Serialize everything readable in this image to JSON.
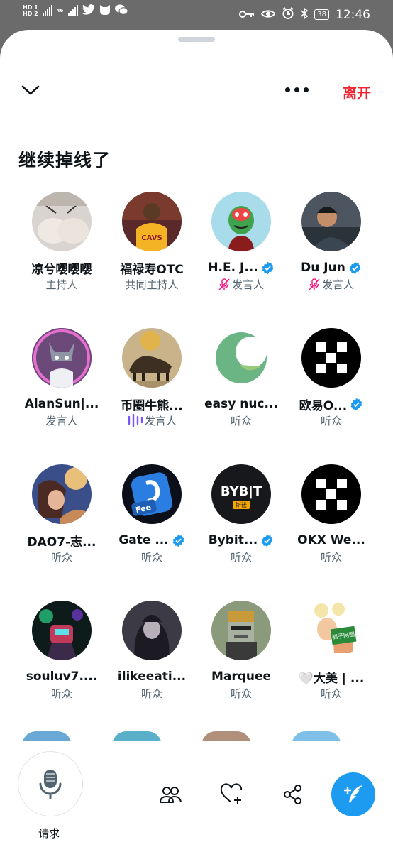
{
  "status_bar": {
    "time": "12:46",
    "battery": "38",
    "sim1": "HD 1",
    "sim2": "HD 2",
    "net": "46"
  },
  "header": {
    "leave_label": "离开",
    "title": "继续掉线了"
  },
  "participants": [
    {
      "name": "凉兮嘤嘤嘤",
      "role": "主持人",
      "verified": false,
      "role_icon": ""
    },
    {
      "name": "福禄寿OTC",
      "role": "共同主持人",
      "verified": false,
      "role_icon": ""
    },
    {
      "name": "H.E. J...",
      "role": "发言人",
      "verified": true,
      "role_icon": "mic-off"
    },
    {
      "name": "Du Jun",
      "role": "发言人",
      "verified": true,
      "role_icon": "mic-off"
    },
    {
      "name": "AlanSun|...",
      "role": "发言人",
      "verified": false,
      "role_icon": ""
    },
    {
      "name": "币圈牛熊...",
      "role": "发言人",
      "verified": false,
      "role_icon": "speaking"
    },
    {
      "name": "easy nuc...",
      "role": "听众",
      "verified": false,
      "role_icon": ""
    },
    {
      "name": "欧易O...",
      "role": "听众",
      "verified": true,
      "role_icon": ""
    },
    {
      "name": "DAO7-志...",
      "role": "听众",
      "verified": false,
      "role_icon": ""
    },
    {
      "name": "Gate ...",
      "role": "听众",
      "verified": true,
      "role_icon": ""
    },
    {
      "name": "Bybit...",
      "role": "听众",
      "verified": true,
      "role_icon": ""
    },
    {
      "name": "OKX We...",
      "role": "听众",
      "verified": false,
      "role_icon": ""
    },
    {
      "name": "souluv7....",
      "role": "听众",
      "verified": false,
      "role_icon": ""
    },
    {
      "name": "ilikeeati...",
      "role": "听众",
      "verified": false,
      "role_icon": ""
    },
    {
      "name": "Marquee",
      "role": "听众",
      "verified": false,
      "role_icon": ""
    },
    {
      "name": "🤍大美 | ...",
      "role": "听众",
      "verified": false,
      "role_icon": ""
    }
  ],
  "avatar_texts": {
    "bybit_logo": "BYB|T",
    "bybit_sub": "斯诺",
    "gate_fee": "Fee",
    "dm_badge": "鹤子网图"
  },
  "bottom_bar": {
    "request_label": "请求"
  },
  "colors": {
    "accent": "#1d9bf0",
    "leave": "#f4212e",
    "speaking": "#7856ff",
    "mic_off": "#f91880"
  }
}
